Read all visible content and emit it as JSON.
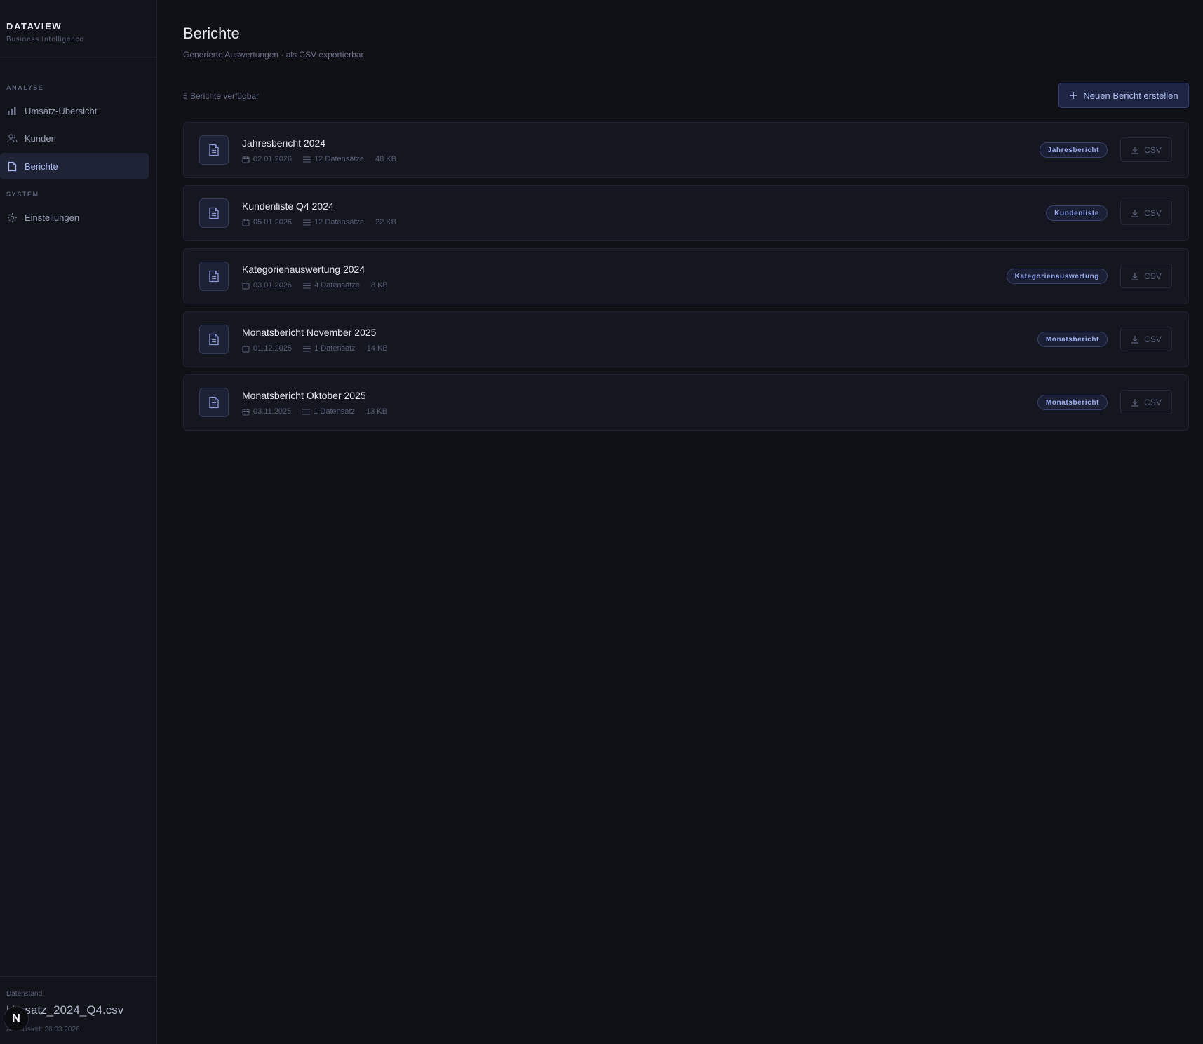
{
  "sidebar": {
    "brand_title": "DATAVIEW",
    "brand_subtitle": "Business Intelligence",
    "sections": [
      {
        "label": "ANALYSE"
      },
      {
        "label": "SYSTEM"
      }
    ],
    "items": [
      {
        "label": "Umsatz-Übersicht",
        "icon": "bar-chart-icon"
      },
      {
        "label": "Kunden",
        "icon": "users-icon"
      },
      {
        "label": "Berichte",
        "icon": "file-icon",
        "active": true
      },
      {
        "label": "Einstellungen",
        "icon": "gear-icon"
      }
    ],
    "footer": {
      "label": "Datenstand",
      "file": "Umsatz_2024_Q4.csv",
      "updated": "Aktualisiert: 26.03.2026"
    },
    "badge": "N"
  },
  "main": {
    "title": "Berichte",
    "subtitle": "Generierte Auswertungen · als CSV exportierbar",
    "count": "5 Berichte verfügbar",
    "new_button": "Neuen Bericht erstellen",
    "reports": [
      {
        "title": "Jahresbericht 2024",
        "date": "02.01.2026",
        "records": "12 Datensätze",
        "size": "48 KB",
        "tag": "Jahresbericht",
        "action": "CSV"
      },
      {
        "title": "Kundenliste Q4 2024",
        "date": "05.01.2026",
        "records": "12 Datensätze",
        "size": "22 KB",
        "tag": "Kundenliste",
        "action": "CSV"
      },
      {
        "title": "Kategorienauswertung 2024",
        "date": "03.01.2026",
        "records": "4 Datensätze",
        "size": "8 KB",
        "tag": "Kategorienauswertung",
        "action": "CSV"
      },
      {
        "title": "Monatsbericht November 2025",
        "date": "01.12.2025",
        "records": "1 Datensatz",
        "size": "14 KB",
        "tag": "Monatsbericht",
        "action": "CSV"
      },
      {
        "title": "Monatsbericht Oktober 2025",
        "date": "03.11.2025",
        "records": "1 Datensatz",
        "size": "13 KB",
        "tag": "Monatsbericht",
        "action": "CSV"
      }
    ]
  },
  "colors": {
    "background": "#0f1117",
    "sidebar": "#12141b",
    "accent": "#9aabf0",
    "card": "#141720"
  }
}
